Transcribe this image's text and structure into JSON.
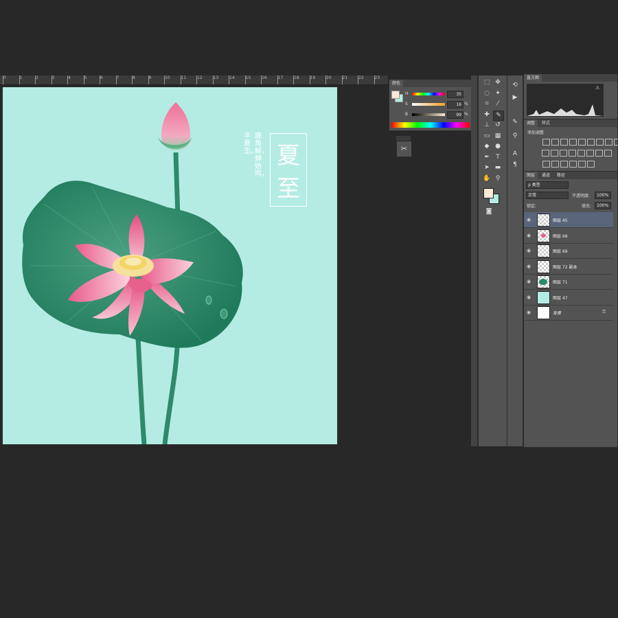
{
  "ruler": {
    "labels": [
      "0",
      "1",
      "2",
      "3",
      "4",
      "5",
      "6",
      "7",
      "8",
      "9",
      "10",
      "11",
      "12",
      "13",
      "14",
      "15",
      "16",
      "17",
      "18",
      "19",
      "20",
      "21",
      "22",
      "23"
    ]
  },
  "artwork": {
    "title_chars": [
      "夏",
      "至"
    ],
    "poem_col1": "鹿角解，蝉始鸣，",
    "poem_col2": "半夏生。",
    "colors": {
      "bg": "#b4ece3",
      "leaf": "#2a8a6a",
      "petal": "#e8608c",
      "stem": "#2e8a6a"
    }
  },
  "color_panel": {
    "tab": "颜色",
    "rows": [
      {
        "label": "H",
        "value": "35",
        "unit": ""
      },
      {
        "label": "S",
        "value": "16",
        "unit": "%"
      },
      {
        "label": "B",
        "value": "99",
        "unit": "%"
      }
    ],
    "foreground": "#fde9d6",
    "background": "#b4ece3"
  },
  "histogram_panel": {
    "tab": "直方图"
  },
  "adjust_panel": {
    "tabs": [
      "调整",
      "样式"
    ],
    "heading": "添加调整"
  },
  "layers_panel": {
    "tabs": [
      "图层",
      "通道",
      "路径"
    ],
    "filter": "ρ 类型",
    "blend_mode": "正常",
    "opacity_label": "不透明度:",
    "opacity_value": "100%",
    "lock_label": "锁定:",
    "fill_label": "填充:",
    "fill_value": "100%",
    "layers": [
      {
        "name": "图层 45",
        "selected": true,
        "thumb": "checker"
      },
      {
        "name": "图层 68",
        "selected": false,
        "thumb": "checker-pink"
      },
      {
        "name": "图层 69",
        "selected": false,
        "thumb": "checker"
      },
      {
        "name": "图层 72 副本",
        "selected": false,
        "thumb": "checker"
      },
      {
        "name": "图层 71",
        "selected": false,
        "thumb": "checker-leaf"
      },
      {
        "name": "图层 47",
        "selected": false,
        "thumb": "mint"
      },
      {
        "name": "背景",
        "selected": false,
        "thumb": "white"
      }
    ]
  },
  "tools": [
    "marquee-icon",
    "move-icon",
    "lasso-icon",
    "magic-wand-icon",
    "crop-icon",
    "eyedropper-icon",
    "healing-icon",
    "brush-icon",
    "stamp-icon",
    "history-brush-icon",
    "eraser-icon",
    "gradient-icon",
    "blur-icon",
    "dodge-icon",
    "pen-icon",
    "type-icon",
    "path-select-icon",
    "shape-icon",
    "hand-icon",
    "zoom-icon"
  ]
}
